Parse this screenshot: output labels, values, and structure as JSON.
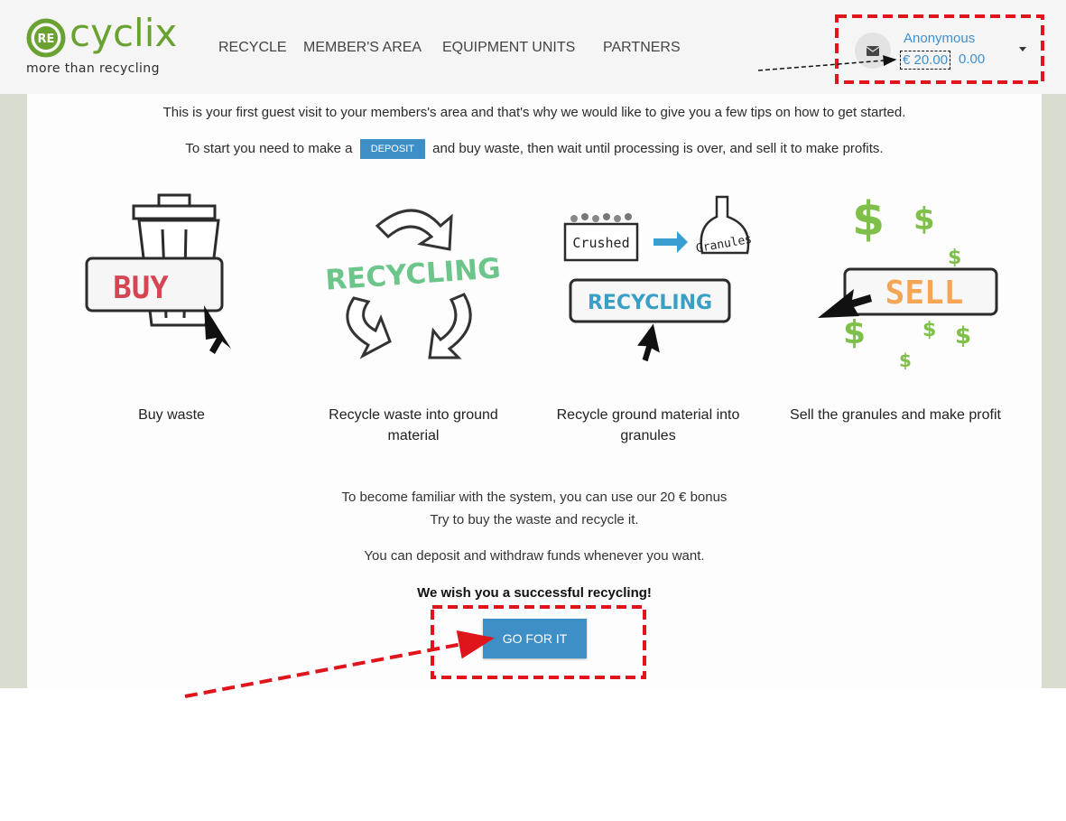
{
  "brand": {
    "logo_mark": "RE",
    "name": "cyclix",
    "tagline": "more than recycling",
    "accent_color": "#6aa232"
  },
  "nav": {
    "items": [
      "RECYCLE",
      "MEMBER'S AREA",
      "EQUIPMENT UNITS",
      "PARTNERS"
    ]
  },
  "user": {
    "name": "Anonymous",
    "bonus_balance": "€ 20.00",
    "balance": "0.00",
    "mail_icon": "envelope-icon",
    "menu_icon": "caret-down-icon"
  },
  "intro": {
    "line1": "This is your first guest visit to your members's area and that's why we would like to give you a few tips on how to get started.",
    "line2_before": "To start you need to make a",
    "deposit_label": "DEPOSIT",
    "line2_after": "and buy waste, then wait until processing is over, and sell it to make profits."
  },
  "steps": [
    {
      "caption": "Buy waste",
      "image_text": "BUY",
      "icon": "trash-can-icon"
    },
    {
      "caption": "Recycle waste into ground material",
      "image_text": "RECYCLING",
      "icon": "recycle-arrows-icon"
    },
    {
      "caption": "Recycle ground material into granules",
      "image_text": "RECYCLING",
      "label_a": "Crushed",
      "label_b": "Granules",
      "icon": "granules-icon"
    },
    {
      "caption": "Sell the granules and make profit",
      "image_text": "SELL",
      "icon": "dollar-icon"
    }
  ],
  "info": {
    "line1": "To become familiar with the system, you can use our 20 € bonus",
    "line2": "Try to buy the waste and recycle it.",
    "line3": "You can deposit and withdraw funds whenever you want.",
    "wish": "We wish you a successful recycling!"
  },
  "cta": {
    "label": "GO FOR IT",
    "color": "#3f8fc7"
  },
  "annotation_color": "#e0141b"
}
